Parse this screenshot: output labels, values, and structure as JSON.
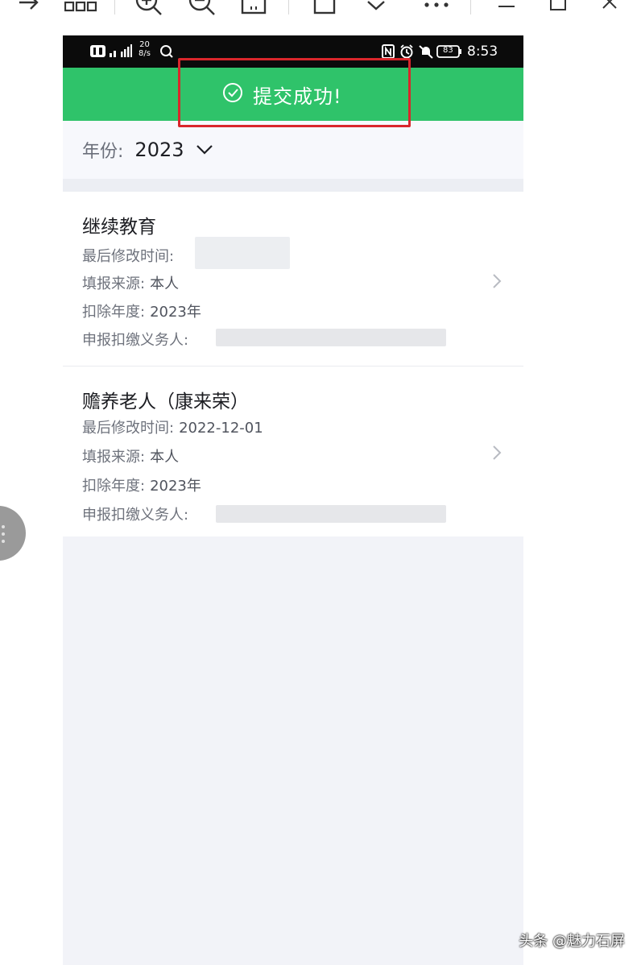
{
  "status_bar": {
    "carrier_hd": "HD",
    "network": "20\n8/s",
    "time": "8:53",
    "battery": "83"
  },
  "toast": {
    "message": "提交成功!",
    "icon": "check-circle-icon"
  },
  "filter": {
    "year_label": "年份:",
    "year_value": "2023"
  },
  "records": [
    {
      "title": "继续教育",
      "modified_label": "最后修改时间:",
      "modified_value": "",
      "source_label": "填报来源:",
      "source_value": "本人",
      "year_label": "扣除年度:",
      "year_value": "2023年",
      "obligor_label": "申报扣缴义务人:",
      "obligor_value": ""
    },
    {
      "title": "赡养老人（康来荣）",
      "modified_label": "最后修改时间:",
      "modified_value": "2022-12-01",
      "source_label": "填报来源:",
      "source_value": "本人",
      "year_label": "扣除年度:",
      "year_value": "2023年",
      "obligor_label": "申报扣缴义务人:",
      "obligor_value": ""
    }
  ],
  "watermark": "头条 @魅力石屏",
  "colors": {
    "success_green": "#2fc36a",
    "highlight_red": "#d9262b"
  }
}
